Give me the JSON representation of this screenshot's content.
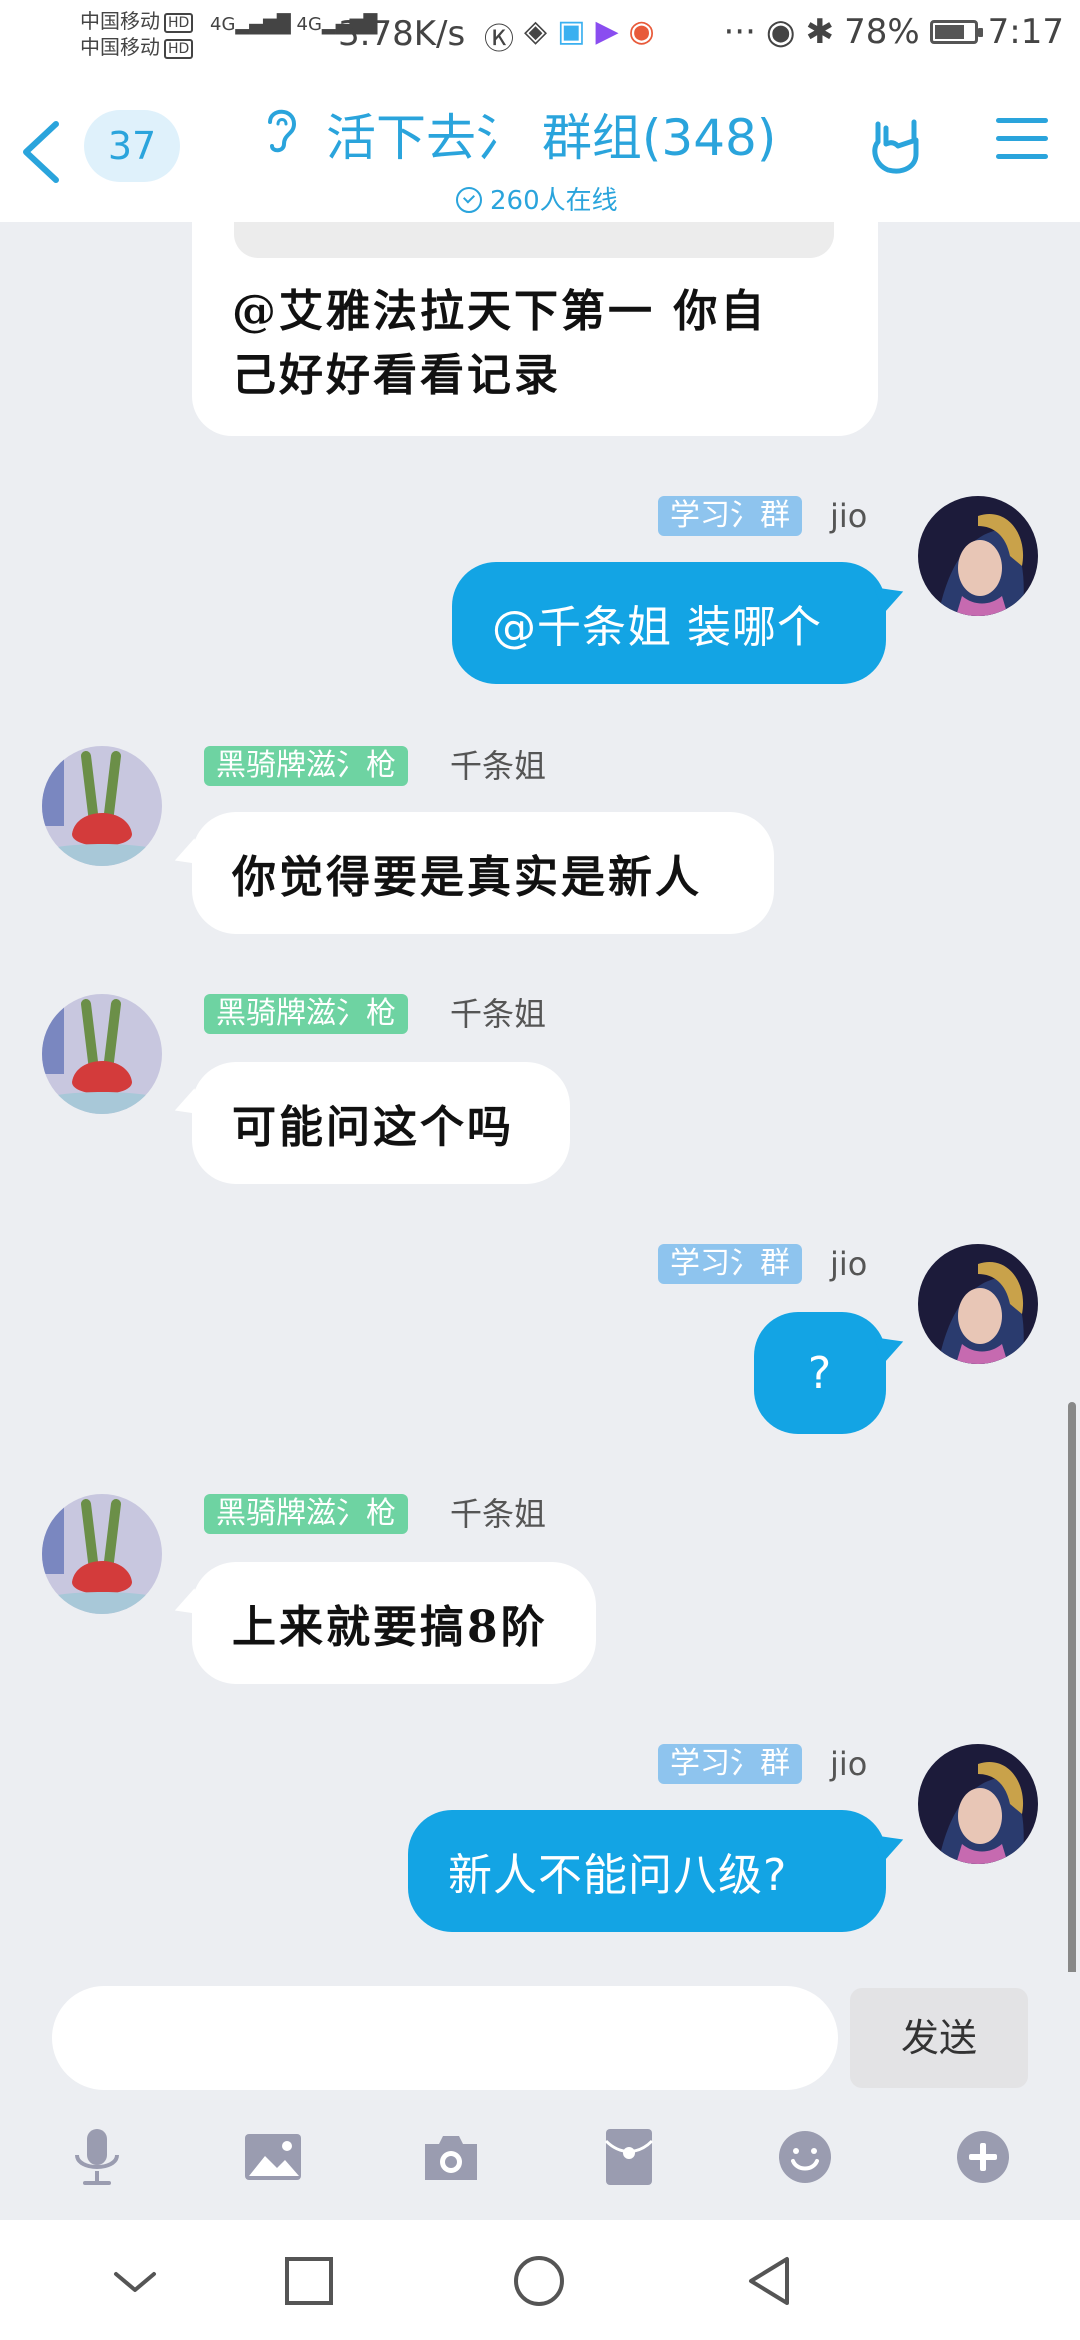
{
  "status_bar": {
    "carrier1": "中国移动",
    "carrier2": "中国移动",
    "hd": "HD",
    "net1": "4G",
    "net2": "4G",
    "speed": "3.78K/s",
    "battery_percent": "78%",
    "battery_level": 0.78,
    "time": "7:17"
  },
  "header": {
    "unread_count": "37",
    "title": "活下去氵 群组(348)",
    "online": "260人在线"
  },
  "messages": [
    {
      "text": "@艾雅法拉天下第一 你自己好好看看记录",
      "line1": "@艾雅法拉天下第一 你自",
      "line2": "己好好看看记录"
    },
    {
      "tag": "学习氵群",
      "sender": "jio",
      "text": "@千条姐 装哪个"
    },
    {
      "tag": "黑骑牌滋氵枪",
      "sender": "千条姐",
      "text": "你觉得要是真实是新人"
    },
    {
      "tag": "黑骑牌滋氵枪",
      "sender": "千条姐",
      "text": "可能问这个吗"
    },
    {
      "tag": "学习氵群",
      "sender": "jio",
      "text": "?"
    },
    {
      "tag": "黑骑牌滋氵枪",
      "sender": "千条姐",
      "text": "上来就要搞8阶"
    },
    {
      "tag": "学习氵群",
      "sender": "jio",
      "text": "新人不能问八级?"
    }
  ],
  "composer": {
    "input_value": "",
    "send_label": "发送"
  },
  "colors": {
    "accent": "#2aa4dc",
    "outgoing_bubble": "#13a4e4",
    "tag_green": "#6ed3a2",
    "tag_blue": "#8ec4ee",
    "background": "#eceef2"
  },
  "icons": [
    "mic-icon",
    "image-icon",
    "camera-icon",
    "red-packet-icon",
    "emoji-icon",
    "plus-icon"
  ]
}
